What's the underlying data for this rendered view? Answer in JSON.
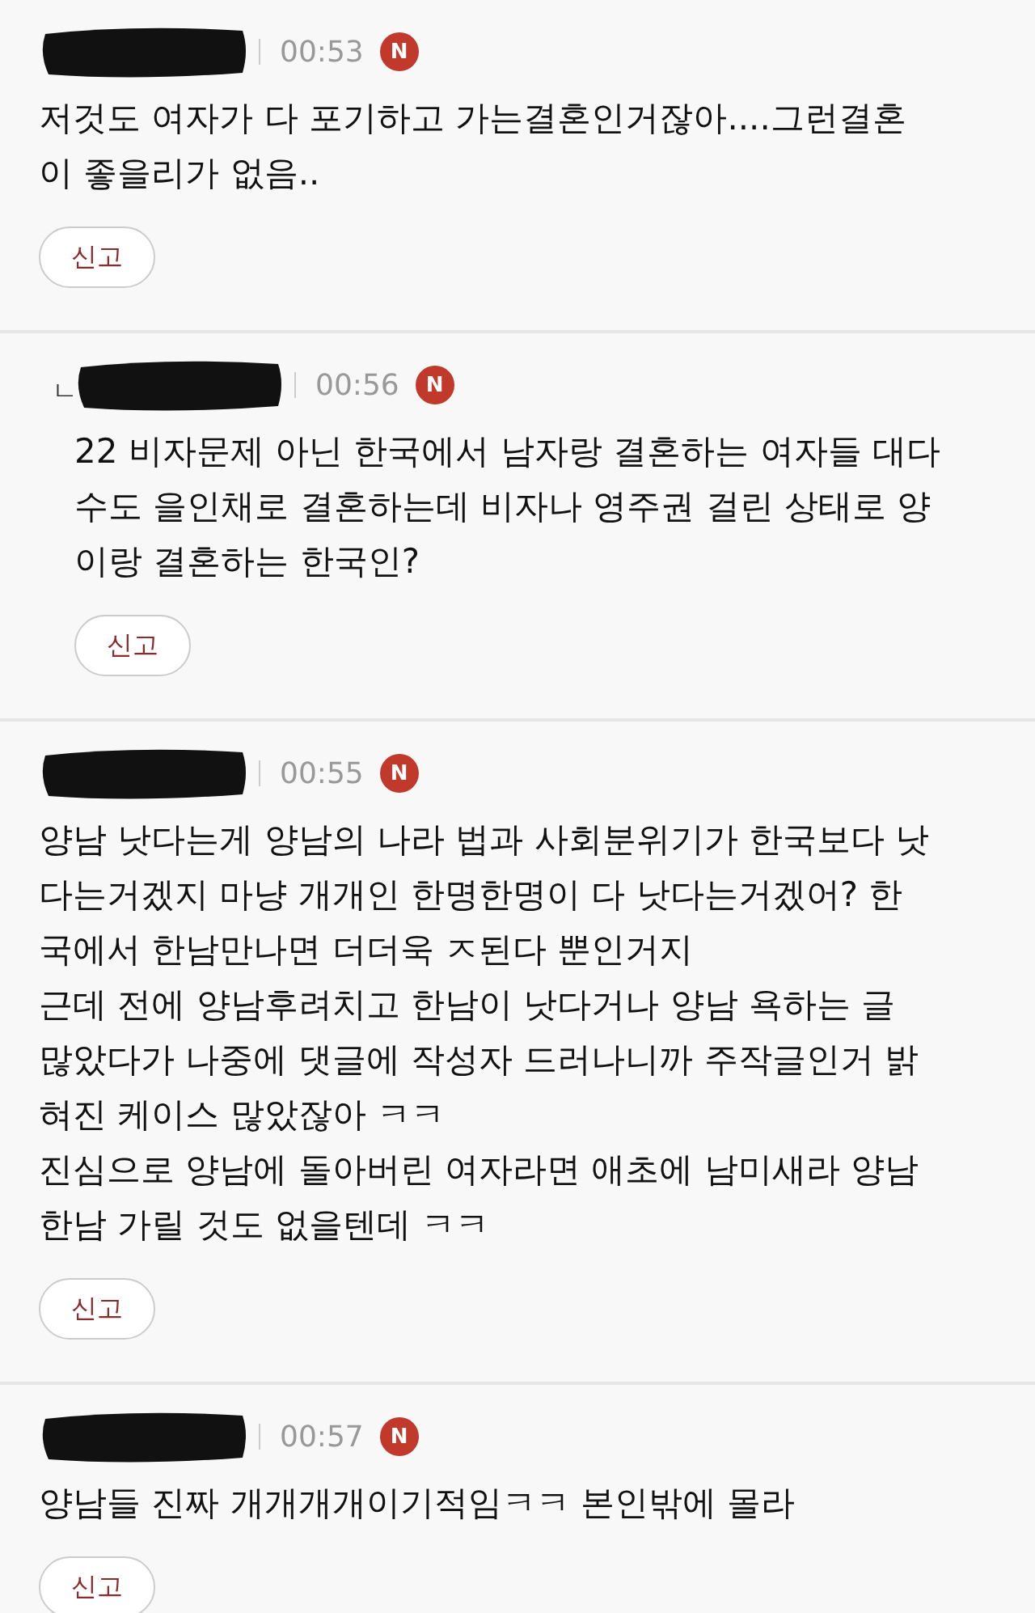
{
  "comments": [
    {
      "time": "00:53",
      "badge": "N",
      "lines": [
        "저것도 여자가 다 포기하고 가는결혼인거잖아....그런결혼",
        "이 좋을리가 없음.."
      ],
      "report": "신고"
    },
    {
      "reply_marker": "ㄴ",
      "time": "00:56",
      "badge": "N",
      "lines": [
        "22 비자문제 아닌 한국에서 남자랑 결혼하는 여자들 대다",
        "수도 을인채로 결혼하는데 비자나 영주권 걸린 상태로 양",
        "이랑 결혼하는 한국인?"
      ],
      "report": "신고"
    },
    {
      "time": "00:55",
      "badge": "N",
      "lines": [
        "양남 낫다는게 양남의 나라 법과 사회분위기가 한국보다 낫",
        "다는거겠지 마냥 개개인 한명한명이 다 낫다는거겠어? 한",
        "국에서 한남만나면 더더욱 ㅈ된다 뿐인거지",
        "근데 전에 양남후려치고 한남이 낫다거나 양남 욕하는 글",
        "많았다가 나중에 댓글에 작성자 드러나니까 주작글인거 밝",
        "혀진 케이스 많았잖아 ㅋㅋ",
        "진심으로 양남에 돌아버린 여자라면 애초에 남미새라 양남",
        "한남 가릴 것도 없을텐데 ㅋㅋ"
      ],
      "report": "신고"
    },
    {
      "time": "00:57",
      "badge": "N",
      "lines": [
        "양남들 진짜 개개개개이기적임ㅋㅋ 본인밖에 몰라"
      ],
      "report": "신고"
    }
  ]
}
